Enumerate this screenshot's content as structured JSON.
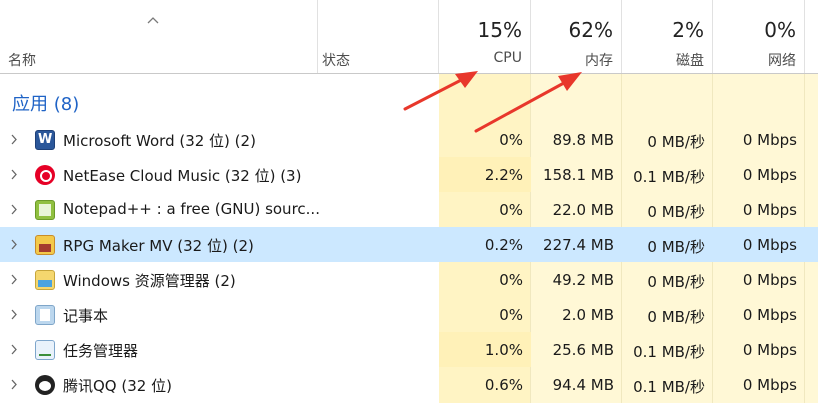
{
  "header": {
    "name_label": "名称",
    "status_label": "状态",
    "cpu": {
      "percent": "15%",
      "label": "CPU"
    },
    "memory": {
      "percent": "62%",
      "label": "内存"
    },
    "disk": {
      "percent": "2%",
      "label": "磁盘"
    },
    "network": {
      "percent": "0%",
      "label": "网络"
    }
  },
  "group": {
    "title": "应用 (8)"
  },
  "rows": [
    {
      "name": "Microsoft Word (32 位) (2)",
      "icon": "word-icon",
      "cpu": "0%",
      "memory": "89.8 MB",
      "disk": "0 MB/秒",
      "network": "0 Mbps"
    },
    {
      "name": "NetEase Cloud Music (32 位) (3)",
      "icon": "netease-cloud-music-icon",
      "cpu": "2.2%",
      "memory": "158.1 MB",
      "disk": "0.1 MB/秒",
      "network": "0 Mbps"
    },
    {
      "name": "Notepad++ : a free (GNU) sourc...",
      "icon": "notepadpp-icon",
      "cpu": "0%",
      "memory": "22.0 MB",
      "disk": "0 MB/秒",
      "network": "0 Mbps"
    },
    {
      "name": "RPG Maker MV (32 位) (2)",
      "icon": "rpg-maker-icon",
      "cpu": "0.2%",
      "memory": "227.4 MB",
      "disk": "0 MB/秒",
      "network": "0 Mbps"
    },
    {
      "name": "Windows 资源管理器 (2)",
      "icon": "explorer-icon",
      "cpu": "0%",
      "memory": "49.2 MB",
      "disk": "0 MB/秒",
      "network": "0 Mbps"
    },
    {
      "name": "记事本",
      "icon": "notepad-icon",
      "cpu": "0%",
      "memory": "2.0 MB",
      "disk": "0 MB/秒",
      "network": "0 Mbps"
    },
    {
      "name": "任务管理器",
      "icon": "task-manager-icon",
      "cpu": "1.0%",
      "memory": "25.6 MB",
      "disk": "0.1 MB/秒",
      "network": "0 Mbps"
    },
    {
      "name": "腾讯QQ (32 位)",
      "icon": "qq-icon",
      "cpu": "0.6%",
      "memory": "94.4 MB",
      "disk": "0.1 MB/秒",
      "network": "0 Mbps"
    }
  ],
  "selected_row_index": 3,
  "colors": {
    "group_title": "#1f63c6",
    "heat_light": "#fff8d6",
    "heat_cpu": "#fff4c4",
    "selection": "#cce8ff",
    "annotation_arrow": "#e8372b"
  }
}
